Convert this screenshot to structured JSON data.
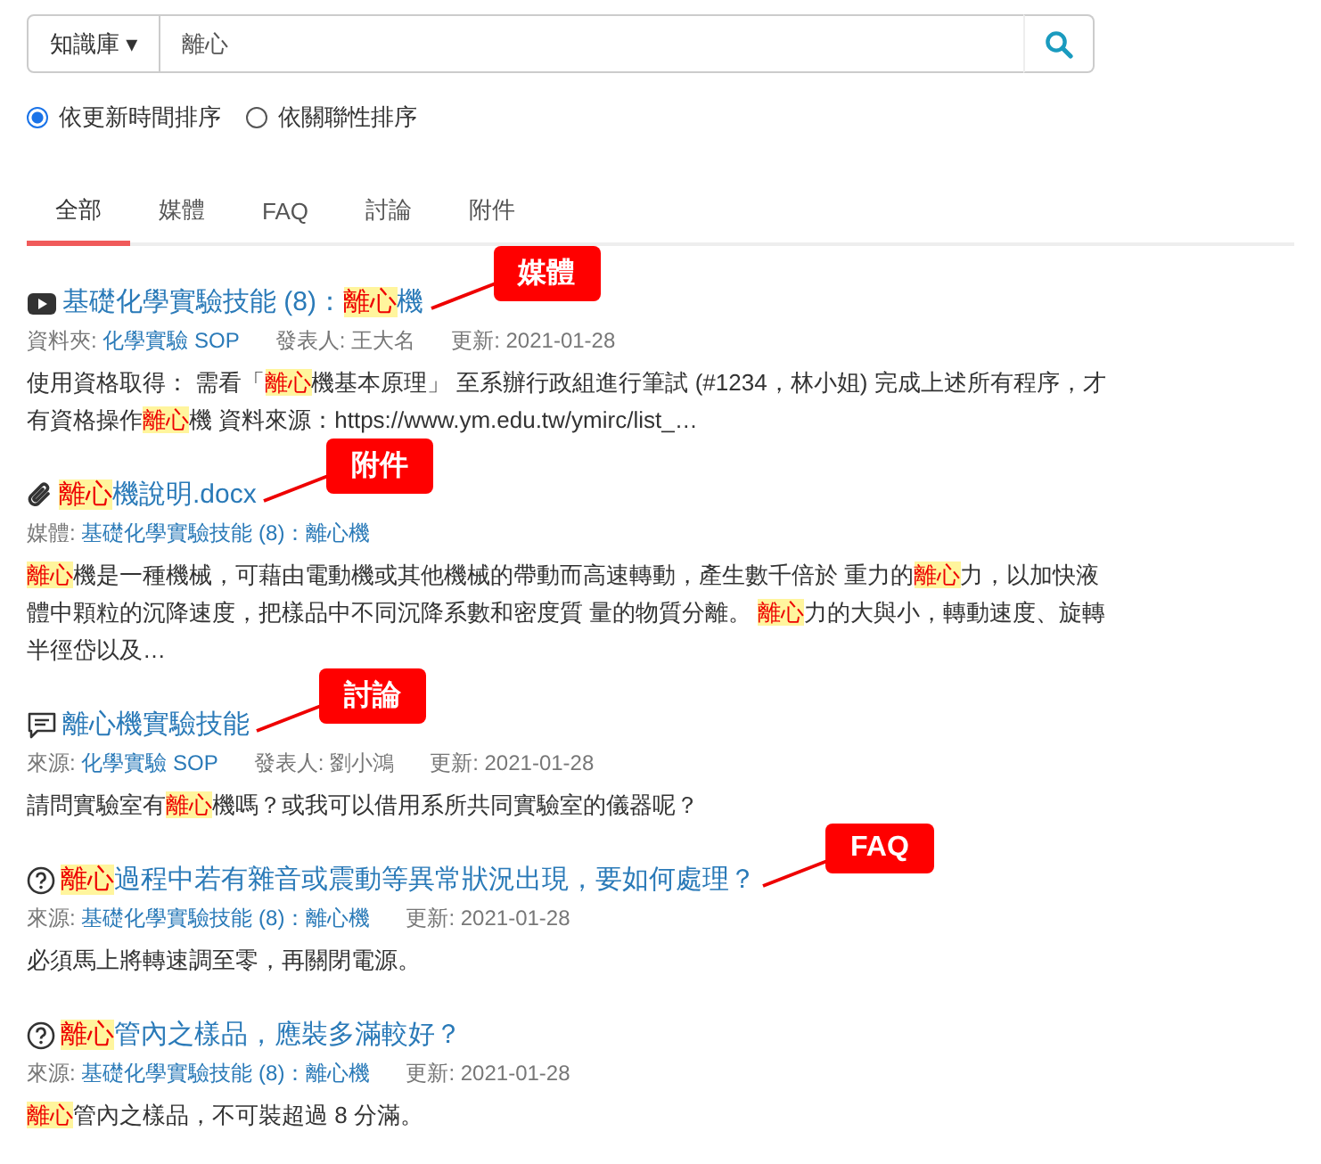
{
  "search": {
    "scope": "知識庫",
    "caret": "▾",
    "value": "離心"
  },
  "sort_options": [
    {
      "label": "依更新時間排序",
      "selected": true
    },
    {
      "label": "依關聯性排序",
      "selected": false
    }
  ],
  "tabs": [
    {
      "label": "全部",
      "selected": true
    },
    {
      "label": "媒體",
      "selected": false
    },
    {
      "label": "FAQ",
      "selected": false
    },
    {
      "label": "討論",
      "selected": false
    },
    {
      "label": "附件",
      "selected": false
    }
  ],
  "results": [
    {
      "kind": "media",
      "callout": "媒體",
      "title": [
        {
          "text": "基礎化學實驗技能 (8)：",
          "highlight": false
        },
        {
          "text": "離心",
          "highlight": true
        },
        {
          "text": "機",
          "highlight": false
        }
      ],
      "meta": [
        {
          "label": "資料夾:",
          "value": "化學實驗 SOP",
          "link": true
        },
        {
          "label": "發表人:",
          "value": "王大名",
          "link": false
        },
        {
          "label": "更新:",
          "value": "2021-01-28",
          "link": false
        }
      ],
      "body": [
        {
          "text": "使用資格取得： 需看「",
          "highlight": false
        },
        {
          "text": "離心",
          "highlight": true
        },
        {
          "text": "機基本原理」 至系辦行政組進行筆試 (#1234，林小姐) 完成上述所有程序，才有資格操作",
          "highlight": false
        },
        {
          "text": "離心",
          "highlight": true
        },
        {
          "text": "機 資料來源：https://www.ym.edu.tw/ymirc/list_…",
          "highlight": false
        }
      ]
    },
    {
      "kind": "attachment",
      "callout": "附件",
      "title": [
        {
          "text": "離心",
          "highlight": true
        },
        {
          "text": "機說明.docx",
          "highlight": false
        }
      ],
      "meta": [
        {
          "label": "媒體:",
          "value": "基礎化學實驗技能 (8)：離心機",
          "link": true
        }
      ],
      "body": [
        {
          "text": "離心",
          "highlight": true
        },
        {
          "text": "機是一種機械，可藉由電動機或其他機械的帶動而高速轉動，產生數千倍於 重力的",
          "highlight": false
        },
        {
          "text": "離心",
          "highlight": true
        },
        {
          "text": "力，以加快液體中顆粒的沉降速度，把樣品中不同沉降系數和密度質 量的物質分離。 ",
          "highlight": false
        },
        {
          "text": "離心",
          "highlight": true
        },
        {
          "text": "力的大與小，轉動速度、旋轉半徑岱以及…",
          "highlight": false
        }
      ]
    },
    {
      "kind": "discussion",
      "callout": "討論",
      "title": [
        {
          "text": "離心機實驗技能",
          "highlight": false
        }
      ],
      "meta": [
        {
          "label": "來源:",
          "value": "化學實驗 SOP",
          "link": true
        },
        {
          "label": "發表人:",
          "value": "劉小鴻",
          "link": false
        },
        {
          "label": "更新:",
          "value": "2021-01-28",
          "link": false
        }
      ],
      "body": [
        {
          "text": "請問實驗室有",
          "highlight": false
        },
        {
          "text": "離心",
          "highlight": true
        },
        {
          "text": "機嗎？或我可以借用系所共同實驗室的儀器呢？",
          "highlight": false
        }
      ]
    },
    {
      "kind": "faq",
      "callout": "FAQ",
      "title": [
        {
          "text": "離心",
          "highlight": true
        },
        {
          "text": "過程中若有雜音或震動等異常狀況出現，要如何處理？",
          "highlight": false
        }
      ],
      "meta": [
        {
          "label": "來源:",
          "value": "基礎化學實驗技能 (8)：離心機",
          "link": true
        },
        {
          "label": "更新:",
          "value": "2021-01-28",
          "link": false
        }
      ],
      "body": [
        {
          "text": "必須馬上將轉速調至零，再關閉電源。",
          "highlight": false
        }
      ]
    },
    {
      "kind": "faq",
      "title": [
        {
          "text": "離心",
          "highlight": true
        },
        {
          "text": "管內之樣品，應裝多滿較好？",
          "highlight": false
        }
      ],
      "meta": [
        {
          "label": "來源:",
          "value": "基礎化學實驗技能 (8)：離心機",
          "link": true
        },
        {
          "label": "更新:",
          "value": "2021-01-28",
          "link": false
        }
      ],
      "body": [
        {
          "text": "離心",
          "highlight": true
        },
        {
          "text": "管內之樣品，不可裝超過 8 分滿。",
          "highlight": false
        }
      ]
    }
  ]
}
